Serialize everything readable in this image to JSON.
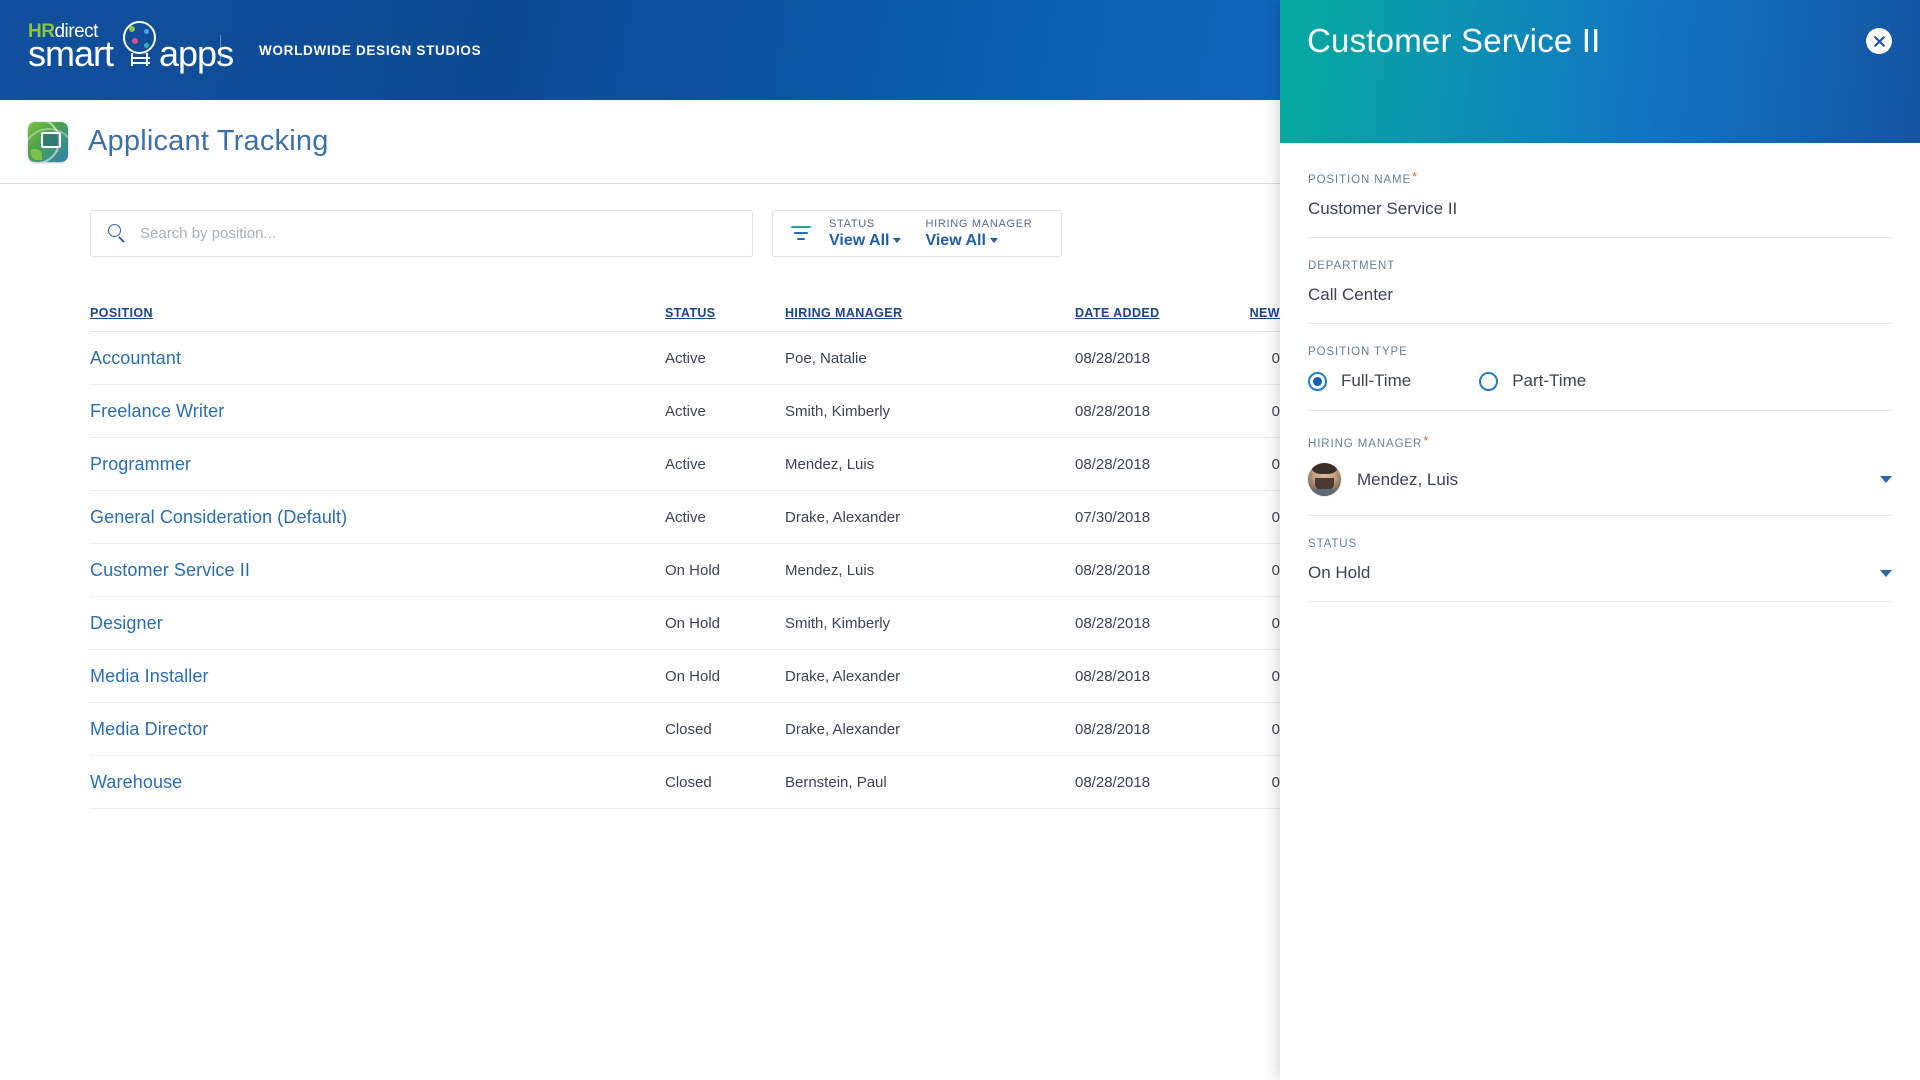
{
  "header": {
    "logo": {
      "hr": "HR",
      "direct": "direct",
      "smart": "smart",
      "apps": "apps"
    },
    "company": "WORLDWIDE DESIGN STUDIOS"
  },
  "page": {
    "title": "Applicant Tracking"
  },
  "search": {
    "placeholder": "Search by position...",
    "value": ""
  },
  "filters": [
    {
      "label": "STATUS",
      "value": "View All"
    },
    {
      "label": "HIRING MANAGER",
      "value": "View All"
    }
  ],
  "table": {
    "columns": [
      "POSITION",
      "STATUS",
      "HIRING MANAGER",
      "DATE ADDED",
      "NEW"
    ],
    "rows": [
      {
        "position": "Accountant",
        "status": "Active",
        "manager": "Poe, Natalie",
        "date": "08/28/2018",
        "new": "0"
      },
      {
        "position": "Freelance Writer",
        "status": "Active",
        "manager": "Smith, Kimberly",
        "date": "08/28/2018",
        "new": "0"
      },
      {
        "position": "Programmer",
        "status": "Active",
        "manager": "Mendez, Luis",
        "date": "08/28/2018",
        "new": "0"
      },
      {
        "position": "General Consideration (Default)",
        "status": "Active",
        "manager": "Drake, Alexander",
        "date": "07/30/2018",
        "new": "0"
      },
      {
        "position": "Customer Service II",
        "status": "On Hold",
        "manager": "Mendez, Luis",
        "date": "08/28/2018",
        "new": "0"
      },
      {
        "position": "Designer",
        "status": "On Hold",
        "manager": "Smith, Kimberly",
        "date": "08/28/2018",
        "new": "0"
      },
      {
        "position": "Media Installer",
        "status": "On Hold",
        "manager": "Drake, Alexander",
        "date": "08/28/2018",
        "new": "0"
      },
      {
        "position": "Media Director",
        "status": "Closed",
        "manager": "Drake, Alexander",
        "date": "08/28/2018",
        "new": "0"
      },
      {
        "position": "Warehouse",
        "status": "Closed",
        "manager": "Bernstein, Paul",
        "date": "08/28/2018",
        "new": "0"
      }
    ]
  },
  "panel": {
    "title": "Customer Service II",
    "close_icon": "close-icon",
    "fields": {
      "position_name": {
        "label": "POSITION NAME",
        "required": true,
        "value": "Customer Service II"
      },
      "department": {
        "label": "DEPARTMENT",
        "required": false,
        "value": "Call Center"
      },
      "position_type": {
        "label": "POSITION TYPE",
        "required": false,
        "options": [
          {
            "label": "Full-Time",
            "selected": true
          },
          {
            "label": "Part-Time",
            "selected": false
          }
        ]
      },
      "hiring_manager": {
        "label": "HIRING MANAGER",
        "required": true,
        "value": "Mendez, Luis"
      },
      "status": {
        "label": "STATUS",
        "required": false,
        "value": "On Hold"
      }
    }
  },
  "colors": {
    "brand_blue": "#11509e",
    "panel_gradient_start": "#05ab9e",
    "panel_gradient_end": "#12559f",
    "link_blue": "#2a6db5",
    "header_link": "#17468f",
    "accent_green": "#8cc63e",
    "required_red": "#e8614d",
    "teal": "#22a9a0"
  }
}
